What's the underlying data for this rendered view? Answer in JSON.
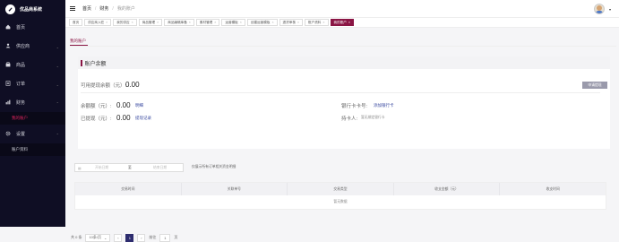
{
  "app": {
    "name": "优品商系统"
  },
  "sidebar": {
    "items": [
      {
        "label": "首页",
        "icon": "home-icon"
      },
      {
        "label": "供应商",
        "icon": "supplier-icon"
      },
      {
        "label": "商品",
        "icon": "goods-icon"
      },
      {
        "label": "订单",
        "icon": "order-icon"
      },
      {
        "label": "财务",
        "icon": "finance-icon"
      }
    ],
    "finance_sub": [
      {
        "label": "我的账户",
        "active": true
      }
    ],
    "settings": {
      "label": "设置",
      "icon": "gear-icon"
    },
    "settings_sub": [
      {
        "label": "账户资料"
      }
    ]
  },
  "breadcrumb": [
    "首页",
    "财务",
    "我的账户"
  ],
  "tabs": [
    "首页",
    "供应商入驻",
    "我的供应",
    "商品管理",
    "商品编辑库备",
    "素材管理",
    "运营模板",
    "创建运营模板",
    "退货审核",
    "账户资料",
    "我的账户"
  ],
  "page": {
    "title": "我的账户"
  },
  "balance": {
    "title": "账户余额",
    "withdrawable_label": "可用提现余额（元）:",
    "withdrawable_value": "0.00",
    "withdraw_button": "申请提现",
    "frozen_label": "余额额（元）:",
    "frozen_value": "0.00",
    "frozen_link": "明细",
    "withdrawn_label": "已提现（元）:",
    "withdrawn_value": "0.00",
    "withdrawn_link": "提现记录",
    "bank_label": "银行卡卡号:",
    "bank_link": "添加银行卡",
    "holder_label": "持卡人:",
    "holder_value": "暂无绑定银行卡"
  },
  "filter": {
    "start_placeholder": "开始日期",
    "sep": "至",
    "end_placeholder": "结束日期",
    "hint": "仅展示所有订单相关资金明细"
  },
  "table": {
    "headers": [
      "交易时间",
      "关联单号",
      "交易类型",
      "收支金额（元）",
      "收支时间"
    ],
    "empty": "暂无数据"
  },
  "pagination": {
    "total": "共 0 条",
    "page_size": "10条/页",
    "current": "1",
    "goto_label": "前往",
    "goto_value": "1",
    "page_suffix": "页"
  },
  "colors": {
    "sidebar_bg": "#0f0e24",
    "accent": "#8a1544",
    "link": "#3a4aa0",
    "pager_active": "#2d2c6e"
  }
}
